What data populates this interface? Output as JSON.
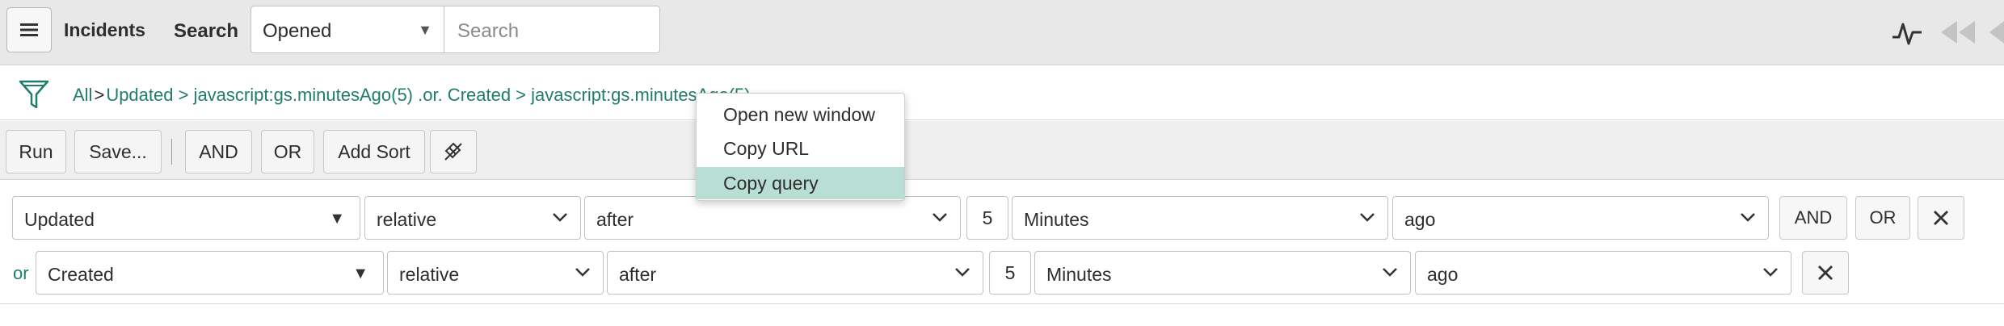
{
  "header": {
    "title": "Incidents",
    "search_label": "Search",
    "filter_select_value": "Opened",
    "search_placeholder": "Search",
    "icons": [
      "menu-icon",
      "activity-icon",
      "first-page-icon",
      "prev-page-icon"
    ]
  },
  "breadcrumb": {
    "root": "All",
    "separator": ">",
    "condition": "Updated > javascript:gs.minutesAgo(5) .or. Created > javascript:gs.minutesAgo(5)"
  },
  "actions": {
    "run": "Run",
    "save": "Save...",
    "and": "AND",
    "or": "OR",
    "add_sort": "Add Sort"
  },
  "conditions": [
    {
      "prefix": "",
      "field": "Updated",
      "mode": "relative",
      "operator": "after",
      "quantity": "5",
      "unit": "Minutes",
      "direction": "ago",
      "and_label": "AND",
      "or_label": "OR"
    },
    {
      "prefix": "or",
      "field": "Created",
      "mode": "relative",
      "operator": "after",
      "quantity": "5",
      "unit": "Minutes",
      "direction": "ago"
    }
  ],
  "context_menu": {
    "items": [
      "Open new window",
      "Copy URL",
      "Copy query"
    ],
    "active_index": 2
  },
  "colors": {
    "accent_link": "#1f7d6c",
    "header_bg": "#e8e8e8",
    "menu_highlight": "#b9ded4"
  }
}
